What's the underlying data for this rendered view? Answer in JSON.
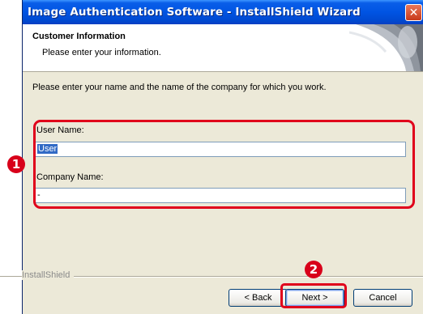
{
  "window": {
    "title": "Image Authentication Software - InstallShield Wizard",
    "close_glyph": "✕"
  },
  "header": {
    "title": "Customer Information",
    "subtitle": "Please enter your information."
  },
  "instruction": "Please enter your name and the name of the company for which you work.",
  "form": {
    "user_name_label": "User Name:",
    "user_name_value": "User",
    "company_name_label": "Company Name:",
    "company_name_value": "-"
  },
  "footer": {
    "brand": "InstallShield"
  },
  "buttons": {
    "back": "< Back",
    "next": "Next >",
    "cancel": "Cancel"
  },
  "annotations": {
    "step1": "1",
    "step2": "2"
  },
  "colors": {
    "title_bar": "#0054e3",
    "dialog_bg": "#ece9d8",
    "annotation": "#e0001b",
    "selection": "#316ac5"
  }
}
